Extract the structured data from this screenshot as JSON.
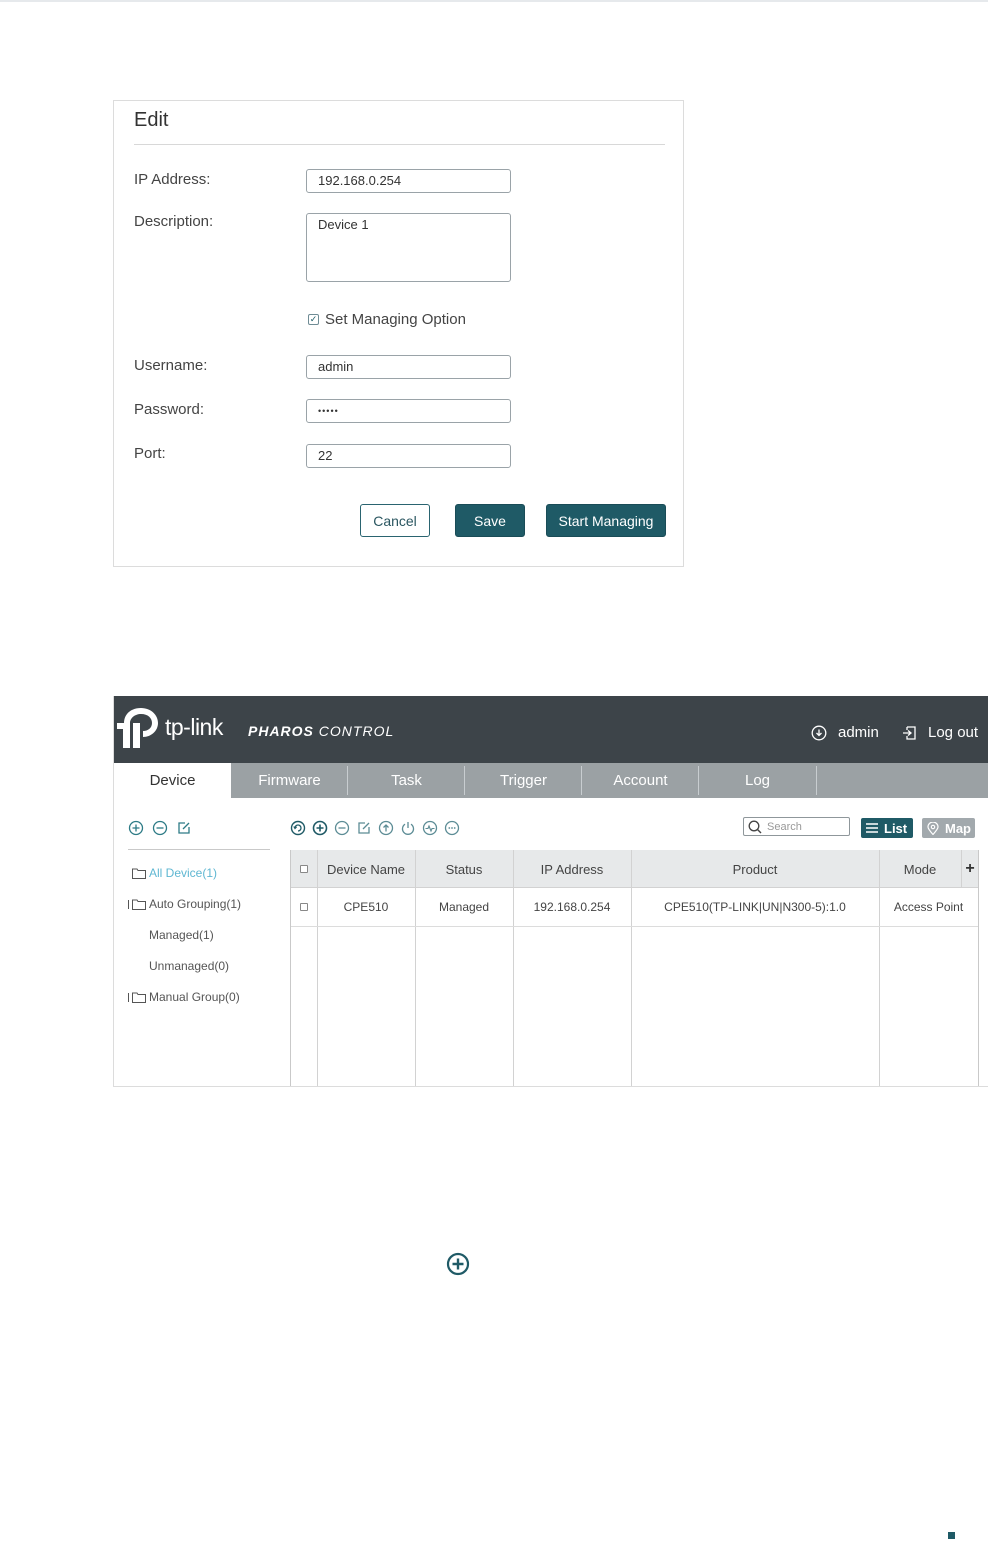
{
  "edit_dialog": {
    "title": "Edit",
    "ip_label": "IP Address:",
    "ip_value": "192.168.0.254",
    "description_label": "Description:",
    "description_value": "Device 1",
    "managing_option_label": "Set Managing Option",
    "managing_option_checked": true,
    "username_label": "Username:",
    "username_value": "admin",
    "password_label": "Password:",
    "password_value": "•••••",
    "port_label": "Port:",
    "port_value": "22",
    "cancel_label": "Cancel",
    "save_label": "Save",
    "start_label": "Start Managing"
  },
  "app": {
    "brand": "tp-link",
    "product_bold": "PHAROS",
    "product_rest": " CONTROL",
    "user": "admin",
    "logout": "Log out",
    "tabs": [
      "Device",
      "Firmware",
      "Task",
      "Trigger",
      "Account",
      "Log"
    ],
    "active_tab": "Device",
    "tree": {
      "all": "All Device(1)",
      "auto": "Auto Grouping(1)",
      "managed": "Managed(1)",
      "unmanaged": "Unmanaged(0)",
      "manual": "Manual Group(0)"
    },
    "search_placeholder": "Search",
    "view_list": "List",
    "view_map": "Map",
    "table": {
      "headers": [
        "Device Name",
        "Status",
        "IP Address",
        "Product",
        "Mode"
      ],
      "rows": [
        [
          "CPE510",
          "Managed",
          "192.168.0.254",
          "CPE510(TP-LINK|UN|N300-5):1.0",
          "Access Point"
        ]
      ]
    }
  },
  "colors": {
    "primary": "#1f5a66",
    "header_bg": "#3d4449",
    "tab_bg": "#9ba1a4",
    "selected_tree": "#5fb7d2"
  }
}
